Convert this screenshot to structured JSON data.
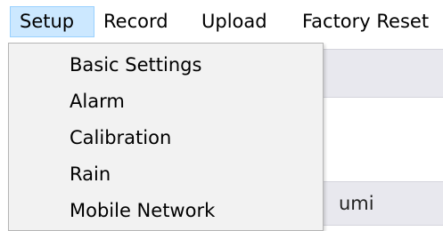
{
  "menubar": {
    "items": [
      {
        "label": "Setup",
        "active": true
      },
      {
        "label": "Record"
      },
      {
        "label": "Upload"
      },
      {
        "label": "Factory Reset"
      }
    ]
  },
  "dropdown": {
    "items": [
      {
        "label": "Basic Settings"
      },
      {
        "label": "Alarm"
      },
      {
        "label": "Calibration"
      },
      {
        "label": "Rain"
      },
      {
        "label": "Mobile Network"
      }
    ]
  },
  "background": {
    "partial_text": "umi"
  },
  "colors": {
    "menu_active_bg": "#cce8ff",
    "menu_active_border": "#99d1ff",
    "dropdown_bg": "#f2f2f2",
    "panel_bg": "#e8e8ee"
  }
}
